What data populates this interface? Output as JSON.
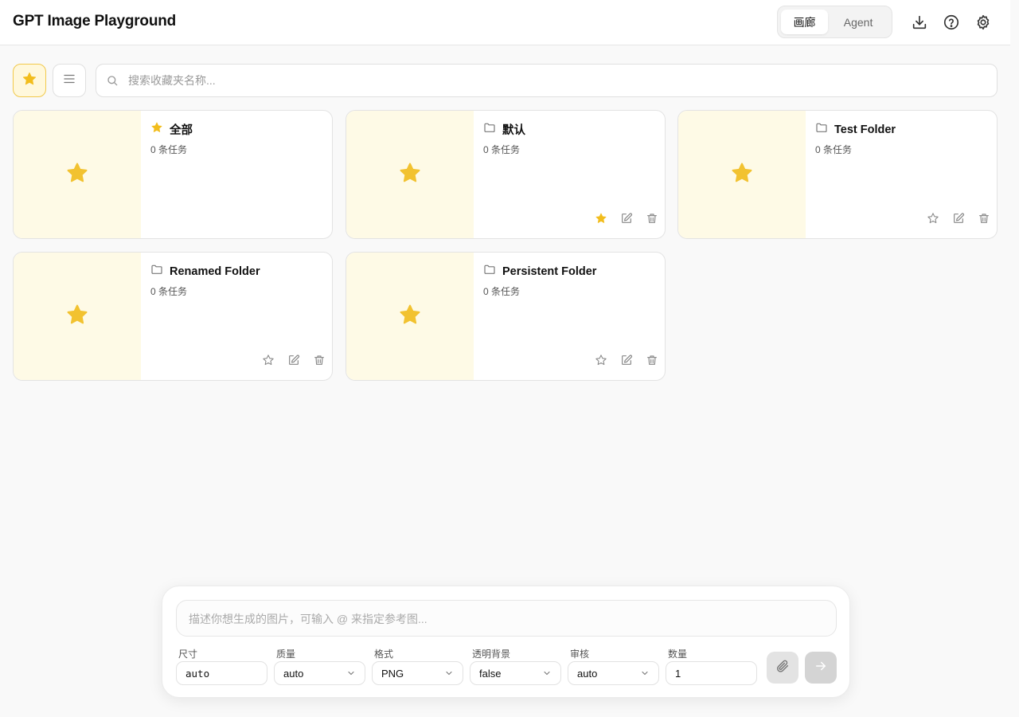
{
  "header": {
    "title": "GPT Image Playground",
    "tabs": [
      {
        "label": "画廊",
        "active": true
      },
      {
        "label": "Agent",
        "active": false
      }
    ],
    "icons": [
      "download-icon",
      "help-icon",
      "settings-icon"
    ]
  },
  "toolbar": {
    "search_placeholder": "搜索收藏夹名称..."
  },
  "folders": [
    {
      "name": "全部",
      "count": "0 条任务",
      "icon": "star-icon",
      "favorited": null
    },
    {
      "name": "默认",
      "count": "0 条任务",
      "icon": "folder-icon",
      "favorited": true
    },
    {
      "name": "Test Folder",
      "count": "0 条任务",
      "icon": "folder-icon",
      "favorited": false
    },
    {
      "name": "Renamed Folder",
      "count": "0 条任务",
      "icon": "folder-icon",
      "favorited": false
    },
    {
      "name": "Persistent Folder",
      "count": "0 条任务",
      "icon": "folder-icon",
      "favorited": false
    }
  ],
  "composer": {
    "prompt_placeholder": "描述你想生成的图片，可输入 @ 来指定参考图...",
    "params": [
      {
        "label": "尺寸",
        "value": "auto"
      },
      {
        "label": "质量",
        "value": "auto"
      },
      {
        "label": "格式",
        "value": "PNG"
      },
      {
        "label": "透明背景",
        "value": "false"
      },
      {
        "label": "审核",
        "value": "auto"
      },
      {
        "label": "数量",
        "value": "1"
      }
    ]
  },
  "colors": {
    "accent_star": "#f2c230",
    "thumb_bg": "#fefae6",
    "page_bg": "#f9f9f9"
  }
}
